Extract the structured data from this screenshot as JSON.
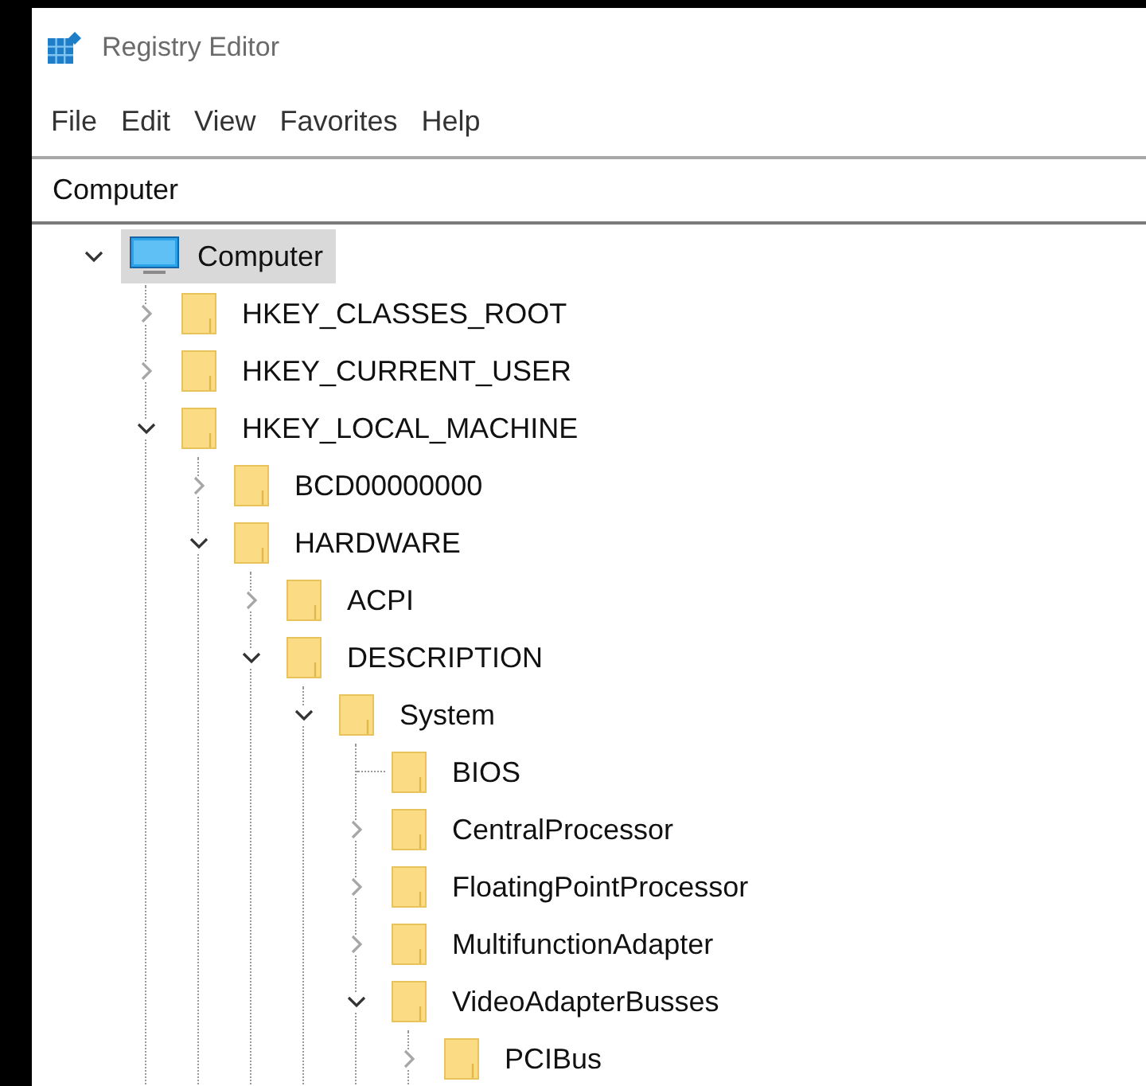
{
  "window": {
    "title": "Registry Editor"
  },
  "menu": [
    "File",
    "Edit",
    "View",
    "Favorites",
    "Help"
  ],
  "address_bar": {
    "value": "Computer"
  },
  "tree": [
    {
      "kind": "computer",
      "label": "Computer",
      "expanded": true,
      "selected": true,
      "children": [
        {
          "kind": "folder",
          "label": "HKEY_CLASSES_ROOT",
          "expanded": false,
          "selected": false
        },
        {
          "kind": "folder",
          "label": "HKEY_CURRENT_USER",
          "expanded": false,
          "selected": false
        },
        {
          "kind": "folder",
          "label": "HKEY_LOCAL_MACHINE",
          "expanded": true,
          "selected": false,
          "children": [
            {
              "kind": "folder",
              "label": "BCD00000000",
              "expanded": false,
              "selected": false
            },
            {
              "kind": "folder",
              "label": "HARDWARE",
              "expanded": true,
              "selected": false,
              "children": [
                {
                  "kind": "folder",
                  "label": "ACPI",
                  "expanded": false,
                  "selected": false
                },
                {
                  "kind": "folder",
                  "label": "DESCRIPTION",
                  "expanded": true,
                  "selected": false,
                  "children": [
                    {
                      "kind": "folder",
                      "label": "System",
                      "expanded": true,
                      "selected": false,
                      "children": [
                        {
                          "kind": "folder",
                          "label": "BIOS",
                          "selected": false
                        },
                        {
                          "kind": "folder",
                          "label": "CentralProcessor",
                          "expanded": false,
                          "selected": false
                        },
                        {
                          "kind": "folder",
                          "label": "FloatingPointProcessor",
                          "expanded": false,
                          "selected": false
                        },
                        {
                          "kind": "folder",
                          "label": "MultifunctionAdapter",
                          "expanded": false,
                          "selected": false
                        },
                        {
                          "kind": "folder",
                          "label": "VideoAdapterBusses",
                          "expanded": true,
                          "selected": false,
                          "children": [
                            {
                              "kind": "folder",
                              "label": "PCIBus",
                              "expanded": false,
                              "selected": false
                            }
                          ]
                        }
                      ]
                    }
                  ]
                }
              ]
            }
          ]
        }
      ]
    }
  ]
}
